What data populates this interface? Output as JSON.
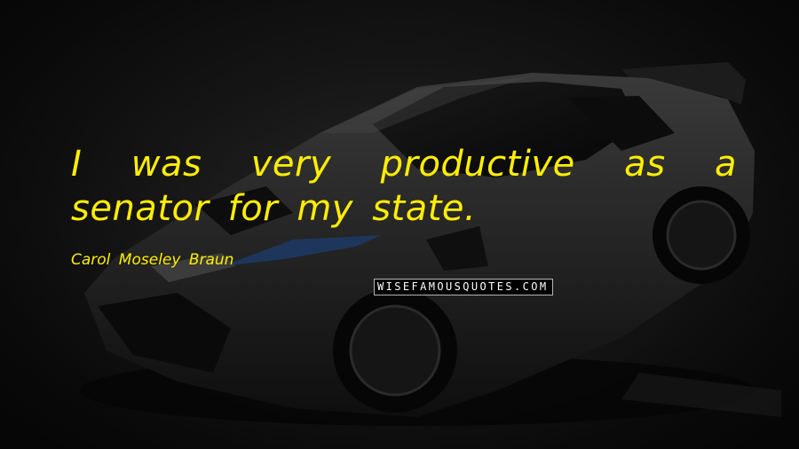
{
  "quote": {
    "text": "I was very productive as a senator for my state.",
    "author": "Carol Moseley Braun"
  },
  "watermark": {
    "text": "WISEFAMOUSQUOTES.COM"
  },
  "background": {
    "subject": "black sports car",
    "accent_color": "#1f3a66"
  },
  "colors": {
    "text": "#ffee00",
    "background": "#0b0b0b"
  }
}
